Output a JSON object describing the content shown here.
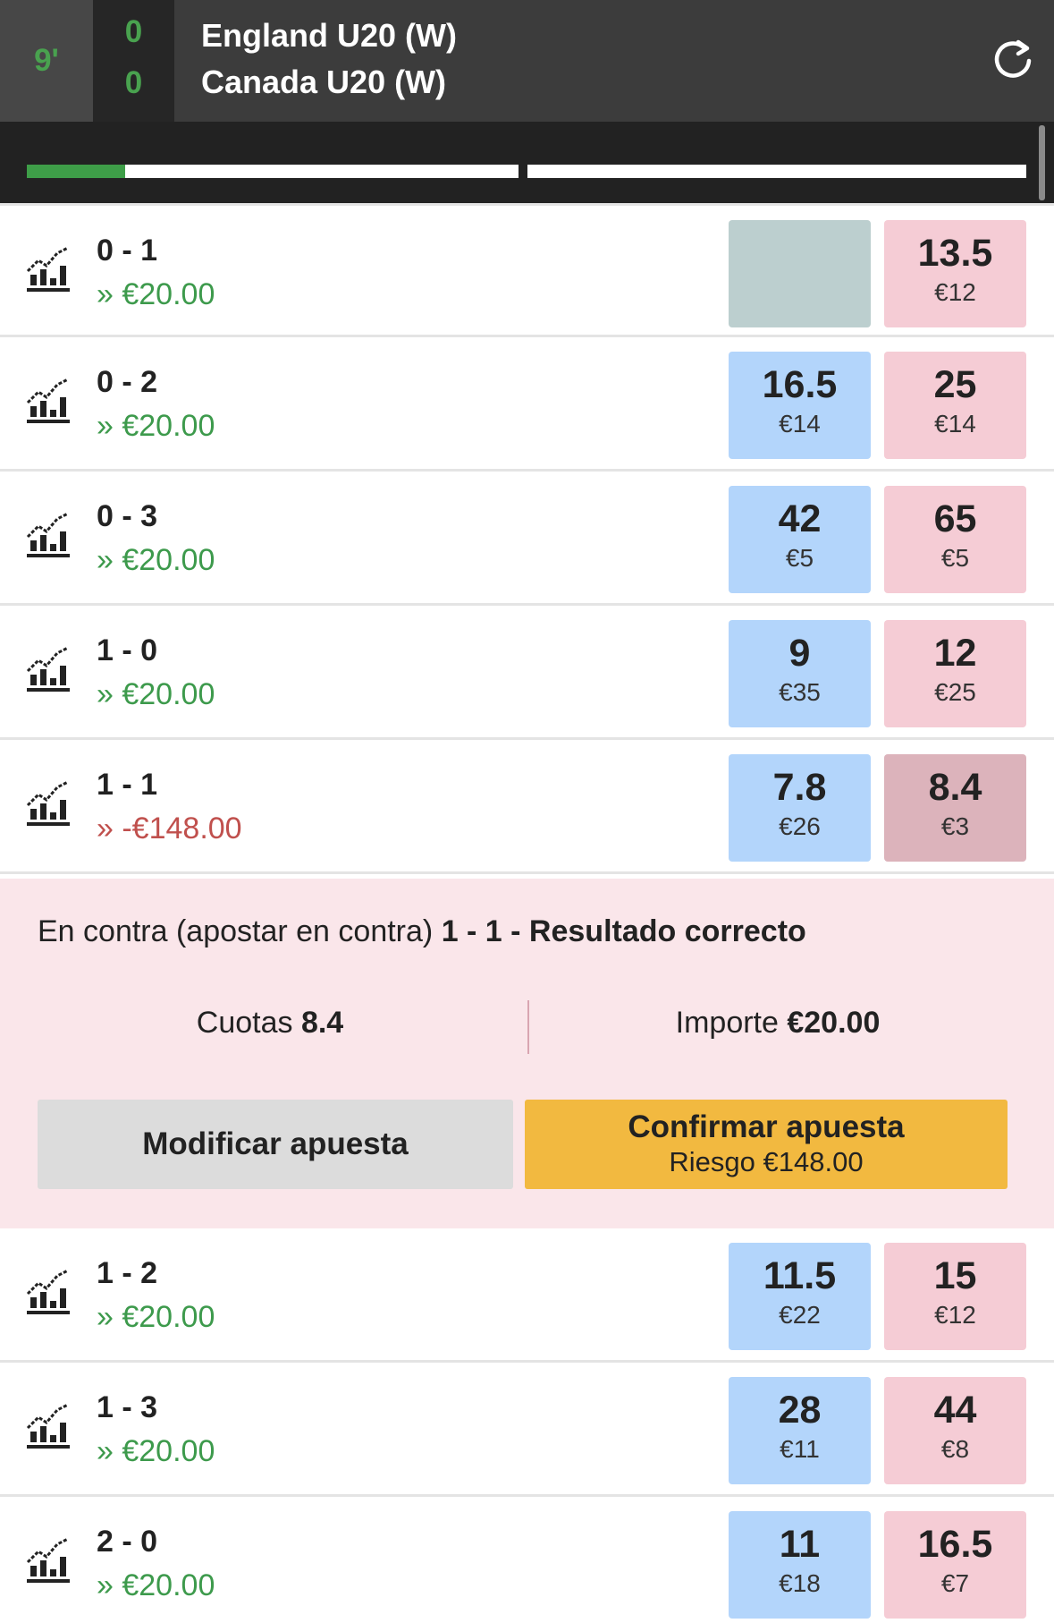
{
  "header": {
    "minute": "9'",
    "score_home": "0",
    "score_away": "0",
    "team_home": "England U20 (W)",
    "team_away": "Canada U20 (W)",
    "refresh_icon": "refresh-icon"
  },
  "progress": {
    "first_half_fraction": 0.2,
    "second_half_fraction": 0,
    "color": "#3e9e48"
  },
  "markets": [
    {
      "score": "0 - 1",
      "pnl": "» €20.00",
      "back_price": "",
      "back_stake": "",
      "lay_price": "13.5",
      "lay_stake": "€12"
    },
    {
      "score": "0 - 2",
      "pnl": "» €20.00",
      "back_price": "16.5",
      "back_stake": "€14",
      "lay_price": "25",
      "lay_stake": "€14"
    },
    {
      "score": "0 - 3",
      "pnl": "» €20.00",
      "back_price": "42",
      "back_stake": "€5",
      "lay_price": "65",
      "lay_stake": "€5"
    },
    {
      "score": "1 - 0",
      "pnl": "» €20.00",
      "back_price": "9",
      "back_stake": "€35",
      "lay_price": "12",
      "lay_stake": "€25"
    },
    {
      "score": "1 - 1",
      "pnl": "» -€148.00",
      "back_price": "7.8",
      "back_stake": "€26",
      "lay_price": "8.4",
      "lay_stake": "€3"
    },
    {
      "score": "1 - 2",
      "pnl": "» €20.00",
      "back_price": "11.5",
      "back_stake": "€22",
      "lay_price": "15",
      "lay_stake": "€12"
    },
    {
      "score": "1 - 3",
      "pnl": "» €20.00",
      "back_price": "28",
      "back_stake": "€11",
      "lay_price": "44",
      "lay_stake": "€8"
    },
    {
      "score": "2 - 0",
      "pnl": "» €20.00",
      "back_price": "11",
      "back_stake": "€18",
      "lay_price": "16.5",
      "lay_stake": "€7"
    }
  ],
  "betslip": {
    "prefix": "En contra (apostar en contra)",
    "selection": "1 - 1 - Resultado correcto",
    "odds_label": "Cuotas",
    "odds_value": "8.4",
    "stake_label": "Importe",
    "stake_value": "€20.00",
    "modify_label": "Modificar apuesta",
    "confirm_label": "Confirmar apuesta",
    "confirm_risk": "Riesgo €148.00"
  },
  "colors": {
    "back": "#b3d5fb",
    "lay": "#f5ccd5",
    "profit": "#3d9a4c",
    "loss": "#c0504d",
    "confirm": "#f2b940"
  }
}
